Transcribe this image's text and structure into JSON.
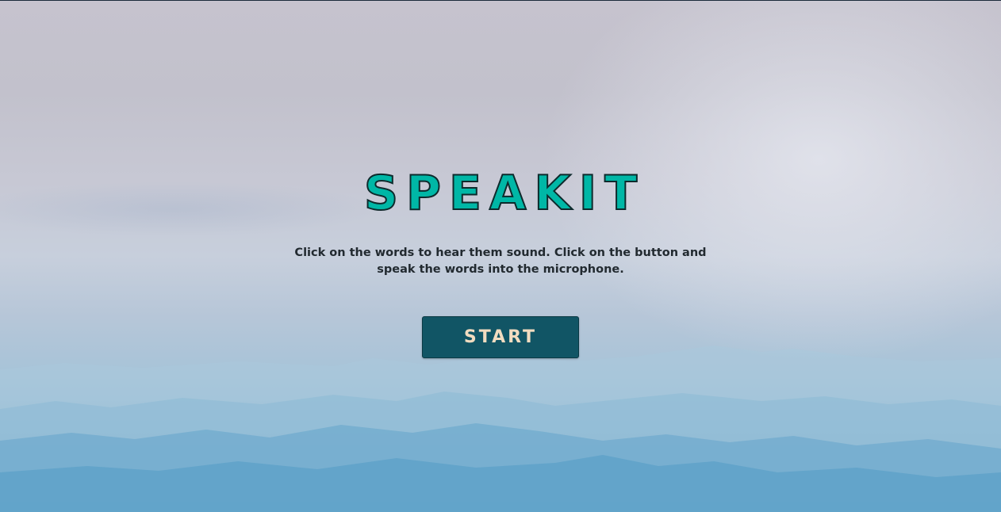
{
  "app": {
    "title": "SPEAKIT",
    "instructions": "Click on the words to hear them sound. Click on the button and speak the words into the microphone.",
    "start_label": "START"
  },
  "colors": {
    "title_fill": "#00b7a6",
    "title_outline": "#0e2a2c",
    "button_bg": "#115565",
    "button_text": "#f2dcc0",
    "text": "#222a30"
  }
}
